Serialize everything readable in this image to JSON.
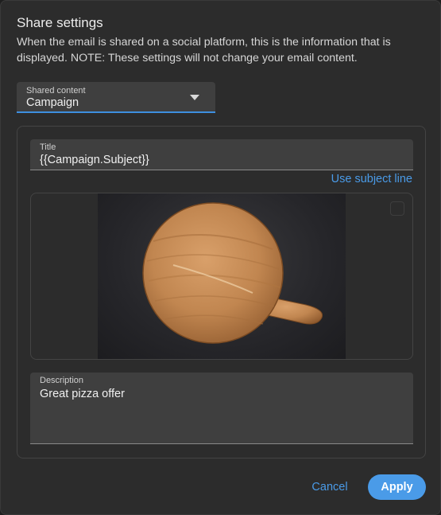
{
  "dialog": {
    "title": "Share settings",
    "description": "When the email is shared on a social platform, this is the information that is displayed. NOTE: These settings will not change your email content."
  },
  "shared_content": {
    "label": "Shared content",
    "value": "Campaign"
  },
  "title_field": {
    "label": "Title",
    "value": "{{Campaign.Subject}}"
  },
  "use_subject_line": "Use subject line",
  "image": {
    "subject": "round wooden pizza board on dark stone surface",
    "colors": {
      "wood": "#c58a52",
      "background": "#2a2a2d"
    }
  },
  "description_field": {
    "label": "Description",
    "value": "Great pizza offer"
  },
  "buttons": {
    "cancel": "Cancel",
    "apply": "Apply"
  },
  "colors": {
    "accent": "#4a9be8",
    "dialog_bg": "#2c2c2c",
    "field_bg": "#3f3f3f"
  }
}
